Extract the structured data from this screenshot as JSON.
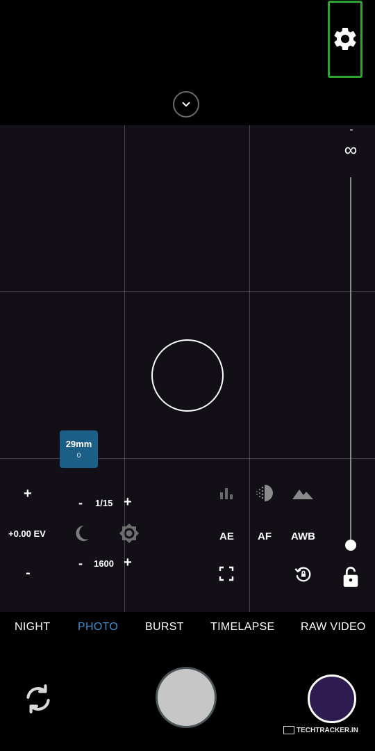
{
  "top": {
    "settings_icon": "gear-icon",
    "collapse_icon": "chevron-down-icon"
  },
  "zoom": {
    "minus_label": "-",
    "infinity_label": "∞",
    "level": 0.0
  },
  "lens": {
    "focal": "29mm",
    "sub": "0"
  },
  "exposure": {
    "plus": "+",
    "value": "+0.00 EV",
    "minus": "-"
  },
  "shutter": {
    "minus": "-",
    "value": "1/15",
    "plus": "+"
  },
  "iso": {
    "minus": "-",
    "value": "1600",
    "plus": "+"
  },
  "locks": {
    "ae": "AE",
    "af": "AF",
    "awb": "AWB"
  },
  "modes": [
    {
      "label": "NIGHT",
      "active": false
    },
    {
      "label": "PHOTO",
      "active": true
    },
    {
      "label": "BURST",
      "active": false
    },
    {
      "label": "TIMELAPSE",
      "active": false
    },
    {
      "label": "RAW VIDEO",
      "active": false
    }
  ],
  "watermark": "TECHTRACKER.IN",
  "colors": {
    "accent": "#3d8fd1",
    "highlight_border": "#2ea32e",
    "lens_badge": "#1c5f86",
    "viewfinder": "#120f17"
  }
}
